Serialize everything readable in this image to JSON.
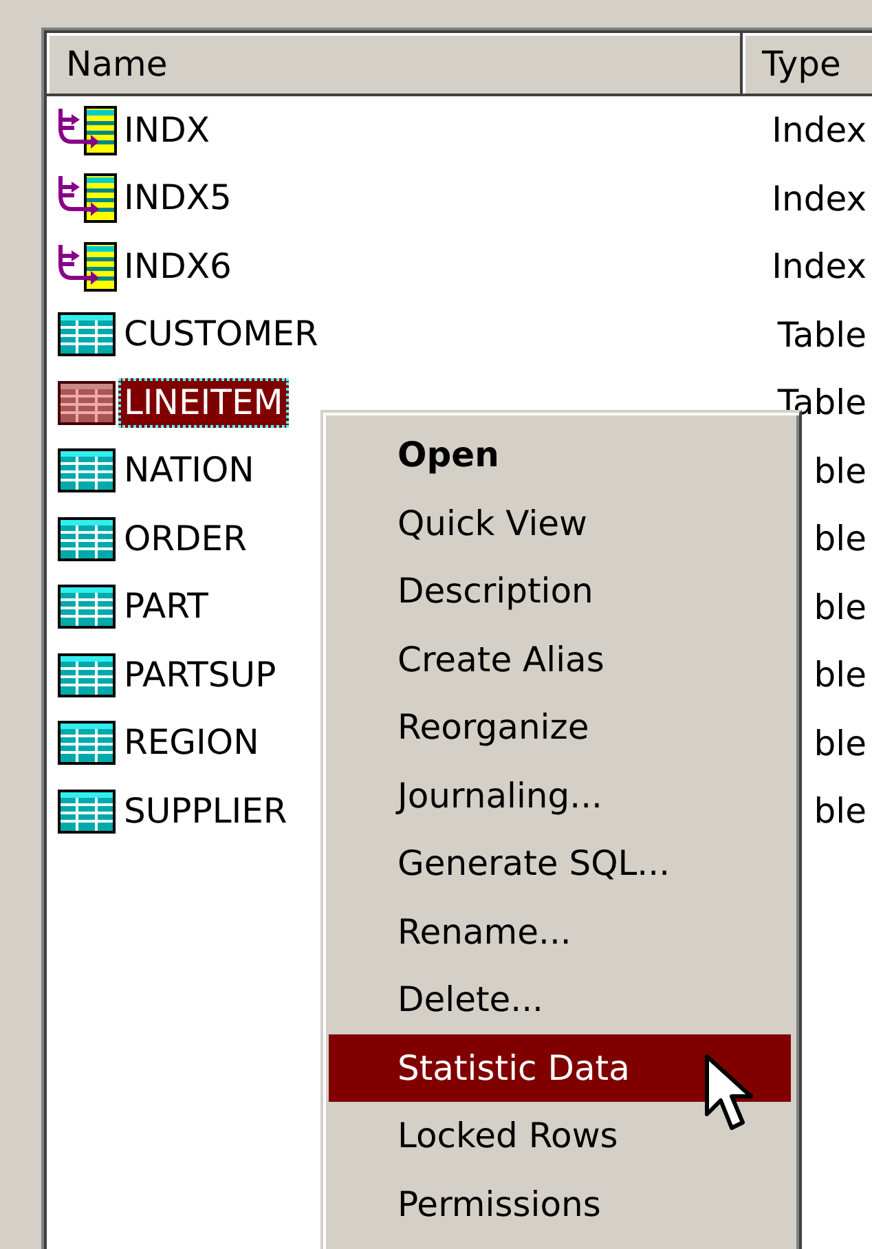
{
  "columns": [
    "Name",
    "Type"
  ],
  "rows": [
    {
      "name": "INDX",
      "type": "Index",
      "kind": "index",
      "selected": false
    },
    {
      "name": "INDX5",
      "type": "Index",
      "kind": "index",
      "selected": false
    },
    {
      "name": "INDX6",
      "type": "Index",
      "kind": "index",
      "selected": false
    },
    {
      "name": "CUSTOMER",
      "type": "Table",
      "kind": "table",
      "selected": false
    },
    {
      "name": "LINEITEM",
      "type": "Table",
      "kind": "table",
      "selected": true
    },
    {
      "name": "NATION",
      "type": "ble",
      "kind": "table",
      "selected": false
    },
    {
      "name": "ORDER",
      "type": "ble",
      "kind": "table",
      "selected": false
    },
    {
      "name": "PART",
      "type": "ble",
      "kind": "table",
      "selected": false
    },
    {
      "name": "PARTSUP",
      "type": "ble",
      "kind": "table",
      "selected": false
    },
    {
      "name": "REGION",
      "type": "ble",
      "kind": "table",
      "selected": false
    },
    {
      "name": "SUPPLIER",
      "type": "ble",
      "kind": "table",
      "selected": false
    }
  ],
  "context_menu": [
    {
      "label": "Open",
      "default": true,
      "selected": false
    },
    {
      "label": "Quick View",
      "default": false,
      "selected": false
    },
    {
      "label": "Description",
      "default": false,
      "selected": false
    },
    {
      "label": "Create Alias",
      "default": false,
      "selected": false
    },
    {
      "label": "Reorganize",
      "default": false,
      "selected": false
    },
    {
      "label": "Journaling...",
      "default": false,
      "selected": false
    },
    {
      "label": "Generate SQL...",
      "default": false,
      "selected": false
    },
    {
      "label": "Rename...",
      "default": false,
      "selected": false
    },
    {
      "label": "Delete...",
      "default": false,
      "selected": false
    },
    {
      "label": "Statistic Data",
      "default": false,
      "selected": true
    },
    {
      "label": "Locked Rows",
      "default": false,
      "selected": false
    },
    {
      "label": "Permissions",
      "default": false,
      "selected": false
    }
  ]
}
